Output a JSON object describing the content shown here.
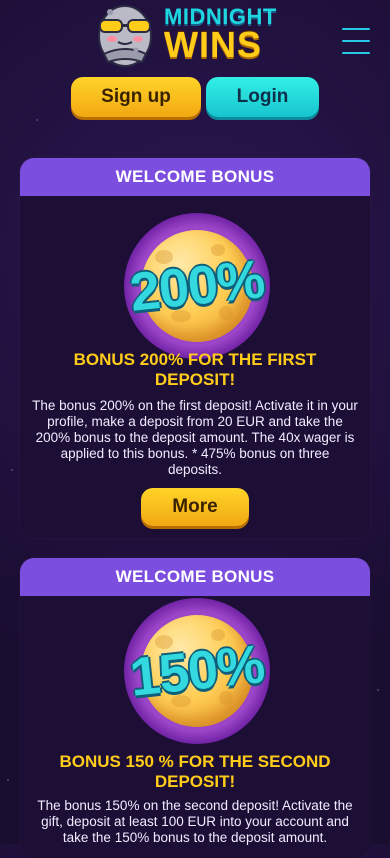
{
  "brand": {
    "top": "MIDNIGHT",
    "bottom": "WINS"
  },
  "header": {
    "signup_label": "Sign up",
    "login_label": "Login",
    "menu_icon": "hamburger-menu-icon"
  },
  "colors": {
    "accent_yellow": "#ffcc1a",
    "accent_cyan": "#1ed6e0",
    "card_header": "#7c4ee0",
    "background": "#1b0f33"
  },
  "bonuses": [
    {
      "header": "WELCOME BONUS",
      "percent": "200%",
      "title": "BONUS 200% FOR THE FIRST DEPOSIT!",
      "text": "The bonus 200% on the first deposit! Activate it in your profile, make a deposit from 20 EUR and take the 200% bonus to the deposit amount. The 40x wager is applied to this bonus. * 475% bonus on three deposits.",
      "more_label": "More"
    },
    {
      "header": "WELCOME BONUS",
      "percent": "150%",
      "title": "BONUS 150 % FOR THE SECOND DEPOSIT!",
      "text": "The bonus 150% on the second deposit! Activate the gift, deposit at least 100 EUR into your account and take the 150% bonus to the deposit amount."
    }
  ]
}
